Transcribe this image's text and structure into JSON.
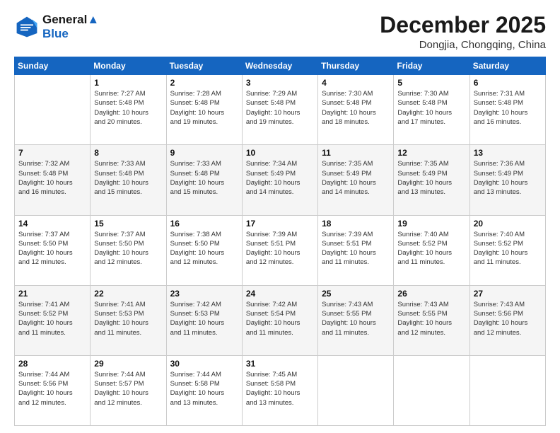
{
  "logo": {
    "line1": "General",
    "line2": "Blue"
  },
  "title": "December 2025",
  "location": "Dongjia, Chongqing, China",
  "days_header": [
    "Sunday",
    "Monday",
    "Tuesday",
    "Wednesday",
    "Thursday",
    "Friday",
    "Saturday"
  ],
  "weeks": [
    [
      {
        "day": "",
        "info": ""
      },
      {
        "day": "1",
        "info": "Sunrise: 7:27 AM\nSunset: 5:48 PM\nDaylight: 10 hours\nand 20 minutes."
      },
      {
        "day": "2",
        "info": "Sunrise: 7:28 AM\nSunset: 5:48 PM\nDaylight: 10 hours\nand 19 minutes."
      },
      {
        "day": "3",
        "info": "Sunrise: 7:29 AM\nSunset: 5:48 PM\nDaylight: 10 hours\nand 19 minutes."
      },
      {
        "day": "4",
        "info": "Sunrise: 7:30 AM\nSunset: 5:48 PM\nDaylight: 10 hours\nand 18 minutes."
      },
      {
        "day": "5",
        "info": "Sunrise: 7:30 AM\nSunset: 5:48 PM\nDaylight: 10 hours\nand 17 minutes."
      },
      {
        "day": "6",
        "info": "Sunrise: 7:31 AM\nSunset: 5:48 PM\nDaylight: 10 hours\nand 16 minutes."
      }
    ],
    [
      {
        "day": "7",
        "info": "Sunrise: 7:32 AM\nSunset: 5:48 PM\nDaylight: 10 hours\nand 16 minutes."
      },
      {
        "day": "8",
        "info": "Sunrise: 7:33 AM\nSunset: 5:48 PM\nDaylight: 10 hours\nand 15 minutes."
      },
      {
        "day": "9",
        "info": "Sunrise: 7:33 AM\nSunset: 5:48 PM\nDaylight: 10 hours\nand 15 minutes."
      },
      {
        "day": "10",
        "info": "Sunrise: 7:34 AM\nSunset: 5:49 PM\nDaylight: 10 hours\nand 14 minutes."
      },
      {
        "day": "11",
        "info": "Sunrise: 7:35 AM\nSunset: 5:49 PM\nDaylight: 10 hours\nand 14 minutes."
      },
      {
        "day": "12",
        "info": "Sunrise: 7:35 AM\nSunset: 5:49 PM\nDaylight: 10 hours\nand 13 minutes."
      },
      {
        "day": "13",
        "info": "Sunrise: 7:36 AM\nSunset: 5:49 PM\nDaylight: 10 hours\nand 13 minutes."
      }
    ],
    [
      {
        "day": "14",
        "info": "Sunrise: 7:37 AM\nSunset: 5:50 PM\nDaylight: 10 hours\nand 12 minutes."
      },
      {
        "day": "15",
        "info": "Sunrise: 7:37 AM\nSunset: 5:50 PM\nDaylight: 10 hours\nand 12 minutes."
      },
      {
        "day": "16",
        "info": "Sunrise: 7:38 AM\nSunset: 5:50 PM\nDaylight: 10 hours\nand 12 minutes."
      },
      {
        "day": "17",
        "info": "Sunrise: 7:39 AM\nSunset: 5:51 PM\nDaylight: 10 hours\nand 12 minutes."
      },
      {
        "day": "18",
        "info": "Sunrise: 7:39 AM\nSunset: 5:51 PM\nDaylight: 10 hours\nand 11 minutes."
      },
      {
        "day": "19",
        "info": "Sunrise: 7:40 AM\nSunset: 5:52 PM\nDaylight: 10 hours\nand 11 minutes."
      },
      {
        "day": "20",
        "info": "Sunrise: 7:40 AM\nSunset: 5:52 PM\nDaylight: 10 hours\nand 11 minutes."
      }
    ],
    [
      {
        "day": "21",
        "info": "Sunrise: 7:41 AM\nSunset: 5:52 PM\nDaylight: 10 hours\nand 11 minutes."
      },
      {
        "day": "22",
        "info": "Sunrise: 7:41 AM\nSunset: 5:53 PM\nDaylight: 10 hours\nand 11 minutes."
      },
      {
        "day": "23",
        "info": "Sunrise: 7:42 AM\nSunset: 5:53 PM\nDaylight: 10 hours\nand 11 minutes."
      },
      {
        "day": "24",
        "info": "Sunrise: 7:42 AM\nSunset: 5:54 PM\nDaylight: 10 hours\nand 11 minutes."
      },
      {
        "day": "25",
        "info": "Sunrise: 7:43 AM\nSunset: 5:55 PM\nDaylight: 10 hours\nand 11 minutes."
      },
      {
        "day": "26",
        "info": "Sunrise: 7:43 AM\nSunset: 5:55 PM\nDaylight: 10 hours\nand 12 minutes."
      },
      {
        "day": "27",
        "info": "Sunrise: 7:43 AM\nSunset: 5:56 PM\nDaylight: 10 hours\nand 12 minutes."
      }
    ],
    [
      {
        "day": "28",
        "info": "Sunrise: 7:44 AM\nSunset: 5:56 PM\nDaylight: 10 hours\nand 12 minutes."
      },
      {
        "day": "29",
        "info": "Sunrise: 7:44 AM\nSunset: 5:57 PM\nDaylight: 10 hours\nand 12 minutes."
      },
      {
        "day": "30",
        "info": "Sunrise: 7:44 AM\nSunset: 5:58 PM\nDaylight: 10 hours\nand 13 minutes."
      },
      {
        "day": "31",
        "info": "Sunrise: 7:45 AM\nSunset: 5:58 PM\nDaylight: 10 hours\nand 13 minutes."
      },
      {
        "day": "",
        "info": ""
      },
      {
        "day": "",
        "info": ""
      },
      {
        "day": "",
        "info": ""
      }
    ]
  ]
}
